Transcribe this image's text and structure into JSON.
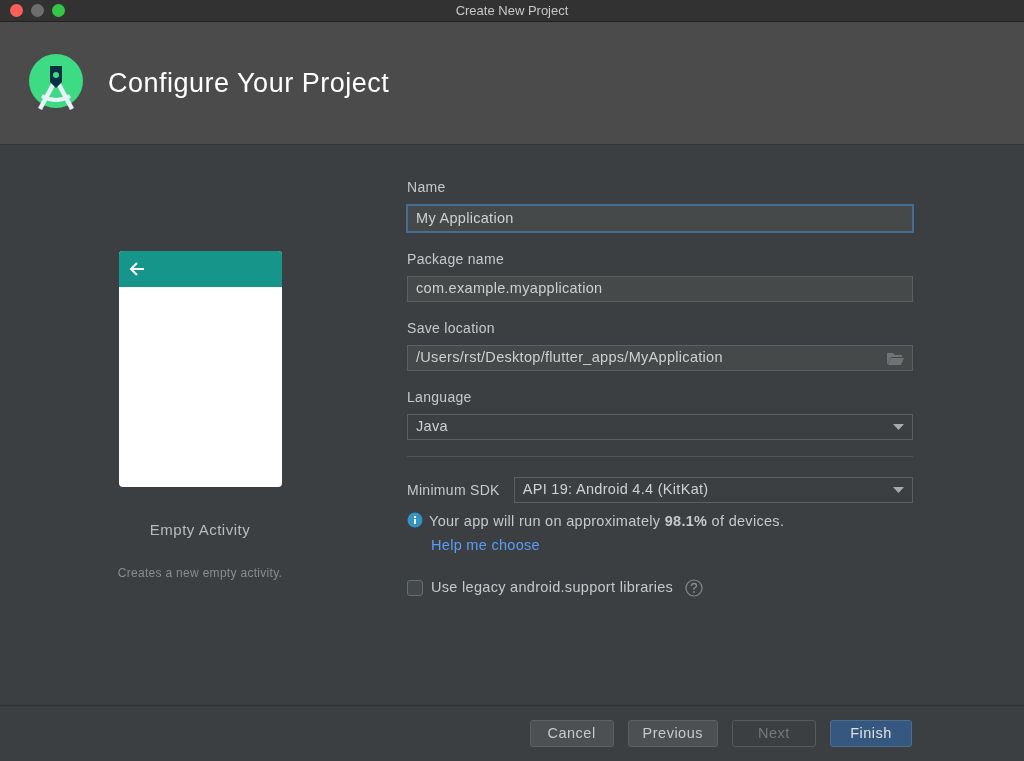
{
  "window": {
    "title": "Create New Project"
  },
  "header": {
    "title": "Configure Your Project"
  },
  "template": {
    "name": "Empty Activity",
    "description": "Creates a new empty activity."
  },
  "fields": [
    {
      "kind": "text",
      "label": "Name",
      "value": "My Application",
      "focused": true
    },
    {
      "kind": "text",
      "label": "Package name",
      "value": "com.example.myapplication",
      "focused": false
    },
    {
      "kind": "path",
      "label": "Save location",
      "value": "/Users/rst/Desktop/flutter_apps/MyApplication",
      "focused": false
    },
    {
      "kind": "dropdown",
      "label": "Language",
      "value": "Java",
      "focused": false
    }
  ],
  "min_sdk": {
    "label": "Minimum SDK",
    "value": "API 19: Android 4.4 (KitKat)"
  },
  "info": {
    "text": "Your app will run on approximately **98.1%** of devices.",
    "link": "Help me choose"
  },
  "legacy_checkbox": {
    "label": "Use legacy android.support libraries",
    "checked": false
  },
  "buttons": [
    {
      "label": "Cancel",
      "kind": "secondary",
      "disabled": false
    },
    {
      "label": "Previous",
      "kind": "secondary",
      "disabled": false
    },
    {
      "label": "Next",
      "kind": "secondary",
      "disabled": true
    },
    {
      "label": "Finish",
      "kind": "primary",
      "disabled": false
    }
  ]
}
